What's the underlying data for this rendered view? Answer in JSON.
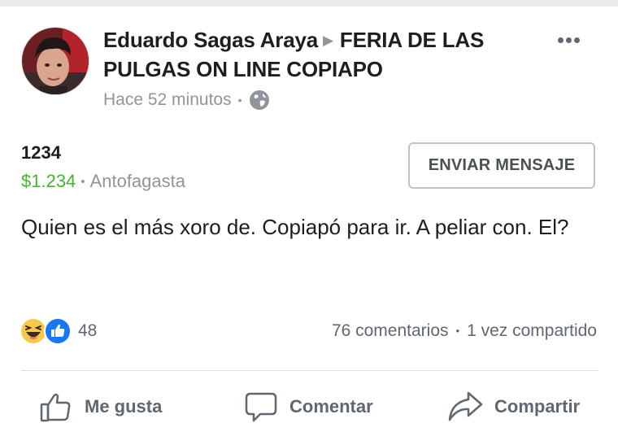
{
  "post": {
    "author": "Eduardo Sagas Araya",
    "group": "FERIA DE LAS PULGAS ON LINE COPIAPO",
    "timestamp": "Hace 52 minutos",
    "privacy_icon": "globe-icon",
    "item": {
      "title": "1234",
      "price": "$1.234",
      "location": "Antofagasta"
    },
    "message_button": "ENVIAR MENSAJE",
    "text": "Quien es el más xoro de. Copiapó para ir. A peliar con. El?"
  },
  "reactions": {
    "icons": [
      "haha-reaction-icon",
      "like-reaction-icon"
    ],
    "count": "48"
  },
  "stats": {
    "comments": "76 comentarios",
    "shares": "1 vez compartido"
  },
  "actions": {
    "like": "Me gusta",
    "comment": "Comentar",
    "share": "Compartir"
  },
  "colors": {
    "price_green": "#42b72a",
    "like_blue": "#1877f2",
    "haha_yellow": "#f7c94a",
    "muted_text": "#90949c"
  }
}
